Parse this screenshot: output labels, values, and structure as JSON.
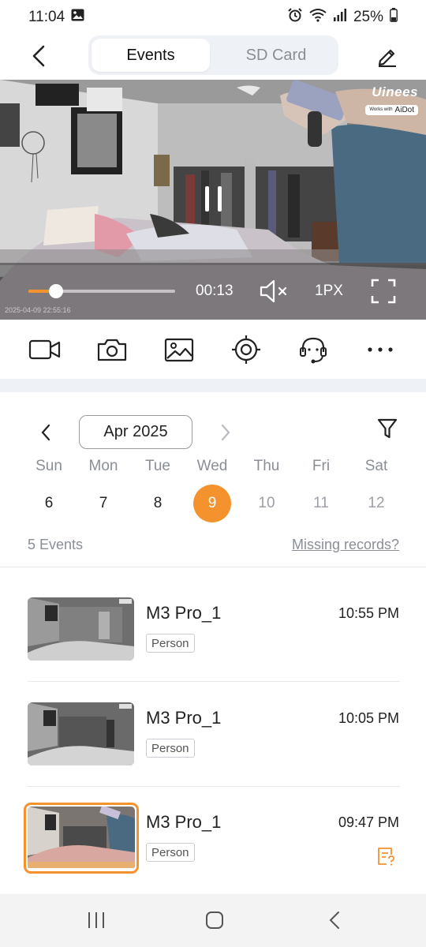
{
  "status_bar": {
    "time": "11:04",
    "battery": "25%"
  },
  "header": {
    "tabs": [
      {
        "label": "Events",
        "active": true
      },
      {
        "label": "SD Card",
        "active": false
      }
    ]
  },
  "player": {
    "brand": "Uinees",
    "badge_small": "Works with",
    "badge_name": "AiDot",
    "timecode": "00:13",
    "quality": "1PX",
    "progress": 0.19,
    "watermark": "2025-04-09 22:55:16"
  },
  "toolbar": {
    "icons": [
      "record-icon",
      "snapshot-icon",
      "gallery-icon",
      "ptz-target-icon",
      "intercom-icon",
      "more-icon"
    ]
  },
  "calendar": {
    "month": "Apr 2025",
    "weekdays": [
      "Sun",
      "Mon",
      "Tue",
      "Wed",
      "Thu",
      "Fri",
      "Sat"
    ],
    "days": [
      "6",
      "7",
      "8",
      "9",
      "10",
      "11",
      "12"
    ],
    "selected_index": 3
  },
  "events_summary": {
    "count_label": "5 Events",
    "missing_link": "Missing records?"
  },
  "events": [
    {
      "title": "M3 Pro_1",
      "tag": "Person",
      "time": "10:55 PM",
      "selected": false
    },
    {
      "title": "M3 Pro_1",
      "tag": "Person",
      "time": "10:05 PM",
      "selected": false
    },
    {
      "title": "M3 Pro_1",
      "tag": "Person",
      "time": "09:47 PM",
      "selected": true
    }
  ],
  "colors": {
    "accent": "#f4932e",
    "muted_text": "#8a8f96",
    "segment_bg": "#eef1f5"
  }
}
